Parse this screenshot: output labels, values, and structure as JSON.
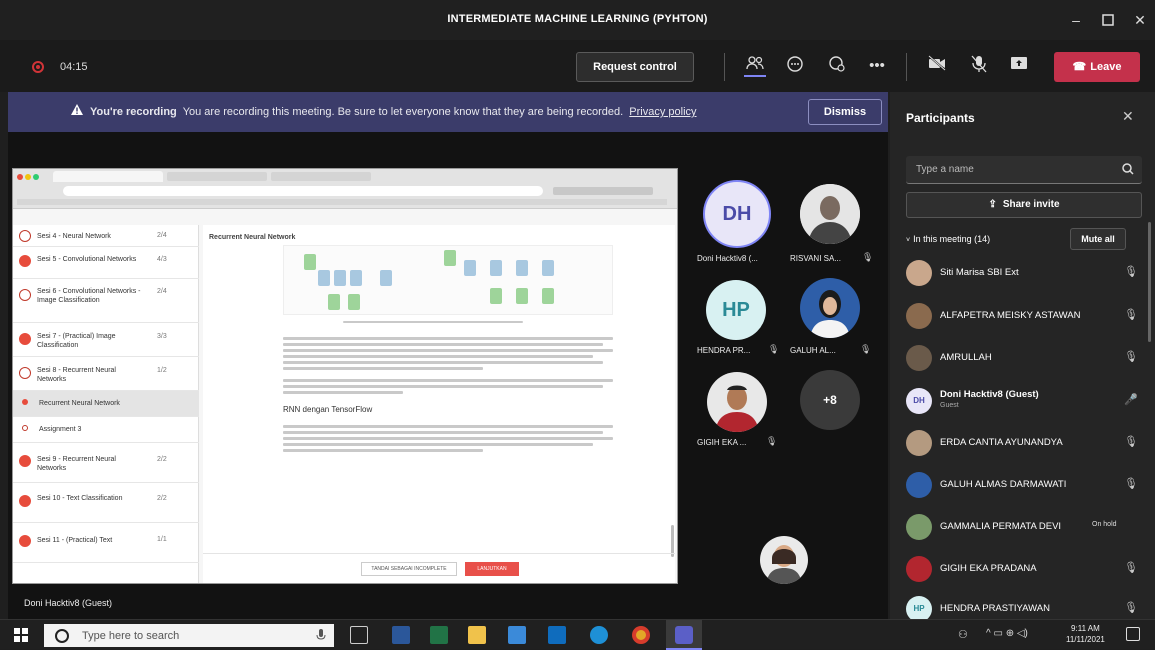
{
  "window": {
    "title": "INTERMEDIATE MACHINE LEARNING (PYHTON)"
  },
  "meeting": {
    "timer": "04:15",
    "request_control": "Request control",
    "leave": "Leave"
  },
  "banner": {
    "heading": "You're recording",
    "message": "You are recording this meeting. Be sure to let everyone know that they are being recorded.",
    "link": "Privacy policy",
    "dismiss": "Dismiss"
  },
  "shared_screen": {
    "doc_title": "Recurrent Neural Network",
    "section_heading": "RNN dengan TensorFlow",
    "sidebar": [
      {
        "label": "Sesi 4 - Neural Network",
        "count": "2/4"
      },
      {
        "label": "Sesi 5 - Convolutional Networks",
        "count": "4/3"
      },
      {
        "label": "Sesi 6 - Convolutional Networks - Image Classification",
        "count": "2/4"
      },
      {
        "label": "Sesi 7 - (Practical) Image Classification",
        "count": "3/3"
      },
      {
        "label": "Sesi 8 - Recurrent Neural Networks",
        "count": "1/2"
      },
      {
        "label": "Recurrent Neural Network",
        "count": ""
      },
      {
        "label": "Assignment 3",
        "count": ""
      },
      {
        "label": "Sesi 9 - Recurrent Neural Networks",
        "count": "2/2"
      },
      {
        "label": "Sesi 10 - Text Classification",
        "count": "2/2"
      },
      {
        "label": "Sesi 11 - (Practical) Text",
        "count": "1/1"
      }
    ],
    "footer_buttons": [
      "TANDAI SEBAGAI INCOMPLETE",
      "LANJUTKAN"
    ]
  },
  "tiles": [
    {
      "initials": "DH",
      "name": "Doni Hacktiv8 (...",
      "initials_bg": "#e8e6f8",
      "initials_color": "#4b4ba8"
    },
    {
      "name": "RISVANI SA..."
    },
    {
      "initials": "HP",
      "name": "HENDRA PR...",
      "initials_bg": "#d8f1f2",
      "initials_color": "#2a8a96"
    },
    {
      "name": "GALUH AL..."
    },
    {
      "name": "GIGIH EKA ..."
    },
    {
      "overflow": "+8"
    }
  ],
  "presenter_tag": "Doni Hacktiv8 (Guest)",
  "participants": {
    "title": "Participants",
    "search_placeholder": "Type a name",
    "share_invite": "Share invite",
    "in_meeting": "In this meeting (14)",
    "mute_all": "Mute all",
    "people": [
      {
        "name": "Siti Marisa SBI Ext",
        "status": ""
      },
      {
        "name": "ALFAPETRA MEISKY ASTAWAN",
        "status": ""
      },
      {
        "name": "AMRULLAH",
        "status": ""
      },
      {
        "name": "Doni Hacktiv8 (Guest)",
        "status": "Guest"
      },
      {
        "name": "ERDA CANTIA AYUNANDYA",
        "status": ""
      },
      {
        "name": "GALUH ALMAS DARMAWATI",
        "status": ""
      },
      {
        "name": "GAMMALIA PERMATA DEVI",
        "status": "On hold"
      },
      {
        "name": "GIGIH EKA PRADANA",
        "status": ""
      },
      {
        "name": "HENDRA PRASTIYAWAN",
        "status": ""
      }
    ]
  },
  "taskbar": {
    "search_placeholder": "Type here to search",
    "time": "9:11 AM",
    "date": "11/11/2021"
  },
  "colors": {
    "leave": "#c4314b",
    "banner": "#3b3c6a",
    "record": "#d13438",
    "accent": "#6264a7"
  }
}
